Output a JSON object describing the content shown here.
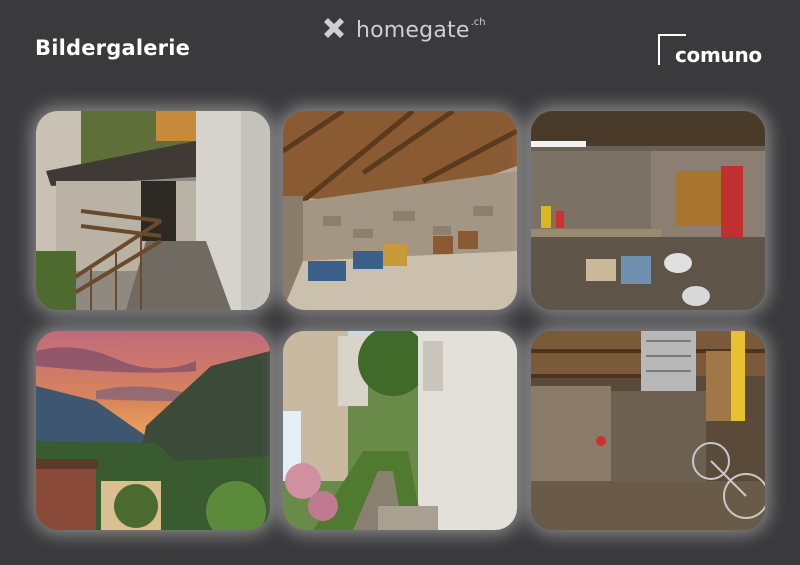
{
  "header": {
    "title": "Bildergalerie",
    "brand": {
      "name": "homegate",
      "tld": ".ch",
      "icon": "x-cross-logo-icon"
    },
    "partner": {
      "name": "comuno",
      "icon": "bracket-logo-icon"
    }
  },
  "colors": {
    "background": "#3a3a3c",
    "text": "#ffffff",
    "muted_logo": "#cfcfd2"
  },
  "gallery": {
    "photos": [
      {
        "subject": "photo-exterior-balcony"
      },
      {
        "subject": "photo-attic-chairs"
      },
      {
        "subject": "photo-workshop"
      },
      {
        "subject": "photo-sunset-valley"
      },
      {
        "subject": "photo-garden-path"
      },
      {
        "subject": "photo-cellar-bicycles"
      }
    ]
  }
}
